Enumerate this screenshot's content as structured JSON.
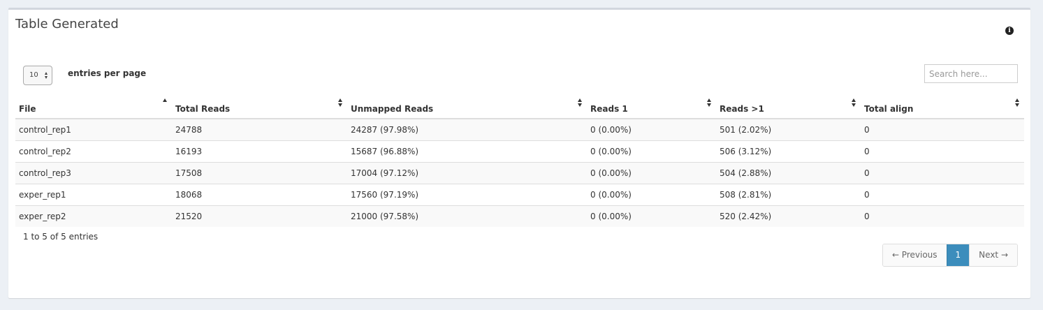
{
  "box": {
    "title": "Table Generated"
  },
  "length": {
    "value": "10",
    "label": "entries per page"
  },
  "search": {
    "placeholder": "Search here..."
  },
  "table": {
    "columns": [
      "File",
      "Total Reads",
      "Unmapped Reads",
      "Reads 1",
      "Reads >1",
      "Total align"
    ],
    "rows": [
      [
        "control_rep1",
        "24788",
        "24287 (97.98%)",
        "0 (0.00%)",
        "501 (2.02%)",
        "0"
      ],
      [
        "control_rep2",
        "16193",
        "15687 (96.88%)",
        "0 (0.00%)",
        "506 (3.12%)",
        "0"
      ],
      [
        "control_rep3",
        "17508",
        "17004 (97.12%)",
        "0 (0.00%)",
        "504 (2.88%)",
        "0"
      ],
      [
        "exper_rep1",
        "18068",
        "17560 (97.19%)",
        "0 (0.00%)",
        "508 (2.81%)",
        "0"
      ],
      [
        "exper_rep2",
        "21520",
        "21000 (97.58%)",
        "0 (0.00%)",
        "520 (2.42%)",
        "0"
      ]
    ]
  },
  "info": "1 to 5 of 5 entries",
  "pagination": {
    "previous": "← Previous",
    "current": "1",
    "next": "Next →"
  },
  "colors": {
    "accent": "#3c8dbc",
    "box_border": "#d2d6de",
    "background": "#ecf0f5"
  }
}
